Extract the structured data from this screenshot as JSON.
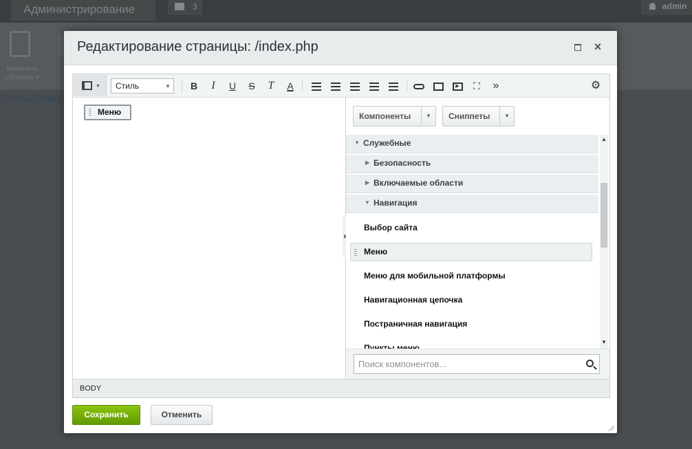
{
  "background": {
    "admin_title": "Администрирование",
    "notifications_count": "3",
    "user_name": "admin",
    "toolbar_label_line1": "Изменить",
    "toolbar_label_line2": "страницу ▾",
    "breadcrumb_link": "Панель Управл"
  },
  "dialog": {
    "title": "Редактирование страницы: /index.php",
    "toolbar": {
      "style_select": "Стиль",
      "bold": "B",
      "italic": "I",
      "underline": "U",
      "strike": "S",
      "clear_format": "T",
      "font_color": "A",
      "more": "»"
    },
    "content": {
      "menu_block_label": "Меню"
    },
    "panel": {
      "components_button": "Компоненты",
      "snippets_button": "Сниппеты",
      "sections": [
        {
          "label": "Служебные",
          "expanded": true
        },
        {
          "label": "Безопасность",
          "expanded": false
        },
        {
          "label": "Включаемые области",
          "expanded": false
        },
        {
          "label": "Навигация",
          "expanded": true
        }
      ],
      "items": [
        "Выбор сайта",
        "Меню",
        "Меню для мобильной платформы",
        "Навигационная цепочка",
        "Постраничная навигация",
        "Пункты меню"
      ],
      "search_placeholder": "Поиск компонентов..."
    },
    "statusbar": "BODY",
    "save_button": "Сохранить",
    "cancel_button": "Отменить"
  }
}
